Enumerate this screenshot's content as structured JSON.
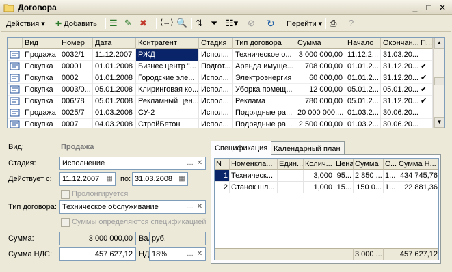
{
  "window": {
    "title": "Договора",
    "minimize": "_",
    "maximize": "□",
    "close": "✕"
  },
  "toolbar": {
    "actions_label": "Действия",
    "add_label": "Добавить",
    "goto_label": "Перейти"
  },
  "grid": {
    "columns": [
      "Вид",
      "Номер",
      "Дата",
      "Контрагент",
      "Стадия",
      "Тип договора",
      "Сумма",
      "Начало",
      "Окончан...",
      "П..."
    ],
    "rows": [
      {
        "kind": "Продажа",
        "number": "0032/1",
        "date": "11.12.2007",
        "counterparty": "РЖД",
        "stage": "Испол...",
        "type": "Техническое о...",
        "sum": "3 000 000,00",
        "start": "11.12.2...",
        "end": "31.03.20...",
        "p": ""
      },
      {
        "kind": "Покупка",
        "number": "00001",
        "date": "01.01.2008",
        "counterparty": "Бизнес центр \"...",
        "stage": "Подгот...",
        "type": "Аренда имуще...",
        "sum": "708 000,00",
        "start": "01.01.2...",
        "end": "31.12.20...",
        "p": "✔"
      },
      {
        "kind": "Покупка",
        "number": "0002",
        "date": "01.01.2008",
        "counterparty": "Городские эле...",
        "stage": "Испол...",
        "type": "Электроэнергия",
        "sum": "60 000,00",
        "start": "01.01.2...",
        "end": "31.12.20...",
        "p": "✔"
      },
      {
        "kind": "Покупка",
        "number": "0003/0...",
        "date": "05.01.2008",
        "counterparty": "Клиринговая ко...",
        "stage": "Испол...",
        "type": "Уборка помещ...",
        "sum": "12 000,00",
        "start": "05.01.2...",
        "end": "05.01.20...",
        "p": "✔"
      },
      {
        "kind": "Покупка",
        "number": "006/78",
        "date": "05.01.2008",
        "counterparty": "Рекламный цен...",
        "stage": "Испол...",
        "type": "Реклама",
        "sum": "780 000,00",
        "start": "05.01.2...",
        "end": "31.12.20...",
        "p": "✔"
      },
      {
        "kind": "Продажа",
        "number": "0025/7",
        "date": "01.03.2008",
        "counterparty": "СУ-2",
        "stage": "Испол...",
        "type": "Подрядные ра...",
        "sum": "20 000 000,...",
        "start": "01.03.2...",
        "end": "30.06.20...",
        "p": ""
      },
      {
        "kind": "Покупка",
        "number": "0007",
        "date": "04.03.2008",
        "counterparty": "СтройБетон",
        "stage": "Испол...",
        "type": "Подрядные ра...",
        "sum": "2 500 000,00",
        "start": "01.03.2...",
        "end": "30.06.20...",
        "p": ""
      }
    ]
  },
  "form": {
    "kind_label": "Вид:",
    "kind_value": "Продажа",
    "stage_label": "Стадия:",
    "stage_value": "Исполнение",
    "valid_label": "Действует с:",
    "valid_from": "11.12.2007",
    "to_label": "по:",
    "valid_to": "31.03.2008",
    "prolong_label": "Пролонгируется",
    "type_label": "Тип договора:",
    "type_value": "Техническое обслуживание",
    "spec_sums_label": "Суммы определяются спецификацией",
    "sum_label": "Сумма:",
    "sum_value": "3 000 000,00",
    "currency_label": "Валюта:",
    "currency_value": "руб.",
    "vat_sum_label": "Сумма НДС:",
    "vat_sum_value": "457 627,12",
    "vat_label": "НДС:",
    "vat_value": "18%"
  },
  "tabs": [
    {
      "label": "Спецификация"
    },
    {
      "label": "Календарный план"
    }
  ],
  "spec": {
    "columns": [
      "N",
      "Номенкла...",
      "Един...",
      "Колич...",
      "Цена",
      "Сумма",
      "С...",
      "Сумма Н..."
    ],
    "rows": [
      {
        "n": "1",
        "item": "Техническ...",
        "unit": "",
        "qty": "3,000",
        "price": "95...",
        "sum": "2 850 ...",
        "s": "1...",
        "vat": "434 745,76"
      },
      {
        "n": "2",
        "item": "Станок шл...",
        "unit": "",
        "qty": "1,000",
        "price": "15...",
        "sum": "150 0...",
        "s": "1...",
        "vat": "22 881,36"
      }
    ],
    "total_sum": "3 000 ...",
    "total_vat": "457 627,12"
  }
}
